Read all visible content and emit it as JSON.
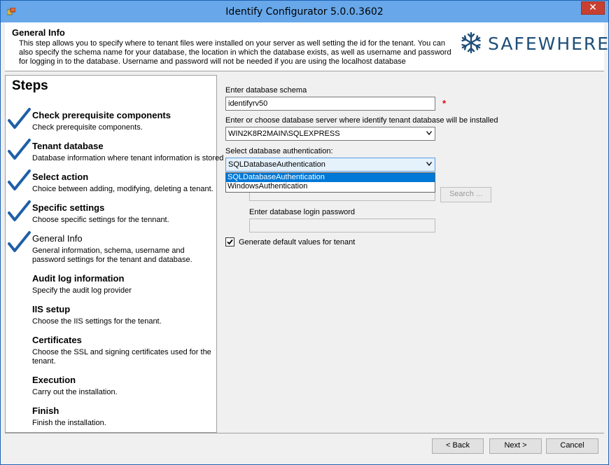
{
  "window": {
    "title": "Identify Configurator 5.0.0.3602",
    "close_glyph": "✕"
  },
  "header": {
    "title": "General Info",
    "description": "This step allows you to specify where to tenant files were installed on your server as well setting the id for the tenant. You can also specify the schema name for your database, the location in which the database exists, as well as username and password for logging in to the database. Username and password will not be needed if you are using the localhost database",
    "logo_text": "SAFEWHERE",
    "logo_color": "#1f4e79"
  },
  "steps": {
    "title": "Steps",
    "items": [
      {
        "name": "Check prerequisite components",
        "desc": "Check prerequisite components.",
        "done": true
      },
      {
        "name": "Tenant database",
        "desc": "Database information where tenant information is stored",
        "done": true
      },
      {
        "name": "Select action",
        "desc": "Choice between adding, modifying, deleting a tenant.",
        "done": true
      },
      {
        "name": "Specific settings",
        "desc": "Choose specific settings for the tennant.",
        "done": true
      },
      {
        "name": "General Info",
        "desc": "General information, schema, username and password settings for the tenant and database.",
        "done": true
      },
      {
        "name": "Audit log information",
        "desc": "Specify the audit log provider",
        "done": false
      },
      {
        "name": "IIS setup",
        "desc": "Choose the IIS settings for the tenant.",
        "done": false
      },
      {
        "name": "Certificates",
        "desc": "Choose the SSL and signing certificates used for the tenant.",
        "done": false
      },
      {
        "name": "Execution",
        "desc": "Carry out the installation.",
        "done": false
      },
      {
        "name": "Finish",
        "desc": "Finish the installation.",
        "done": false
      }
    ]
  },
  "form": {
    "schema_label": "Enter database schema",
    "schema_value": "identifyrv50",
    "required_marker": "*",
    "server_label": "Enter or choose database server where identify tenant database will be installed",
    "server_value": "WIN2K8R2MAIN\\SQLEXPRESS",
    "auth_label": "Select database authentication:",
    "auth_value": "SQLDatabaseAuthentication",
    "auth_options": [
      "SQLDatabaseAuthentication",
      "WindowsAuthentication"
    ],
    "search_label": "Search ...",
    "password_label": "Enter database login password",
    "generate_label": "Generate default values for tenant",
    "generate_checked": true
  },
  "footer": {
    "back_label": "< Back",
    "next_label": "Next >",
    "cancel_label": "Cancel"
  },
  "colors": {
    "titlebar": "#67a7ea",
    "close": "#c84031",
    "check": "#1f5fa8",
    "selection": "#0078d7"
  }
}
